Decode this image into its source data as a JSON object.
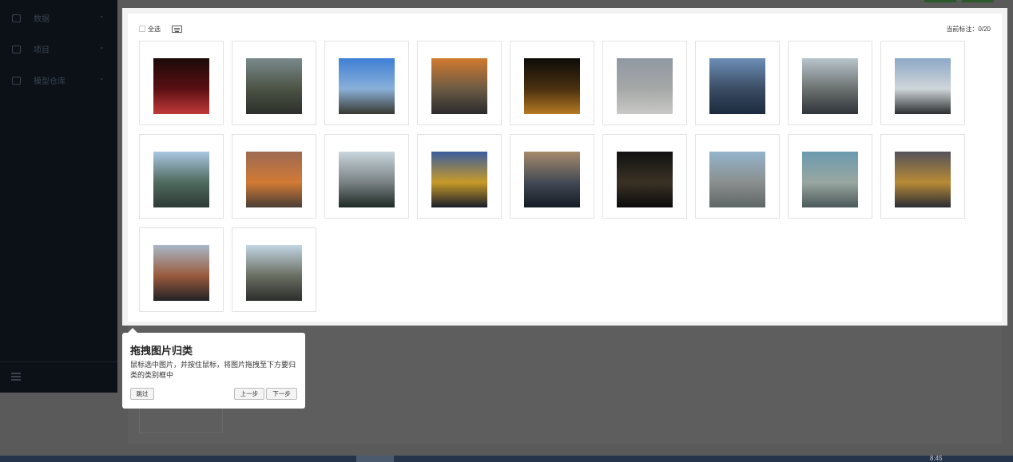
{
  "sidebar": {
    "items": [
      {
        "label": "数据",
        "icon": "database-icon"
      },
      {
        "label": "项目",
        "icon": "project-icon"
      },
      {
        "label": "模型仓库",
        "icon": "model-repo-icon"
      }
    ],
    "collapse_icon": "menu-collapse-icon"
  },
  "toolbar": {
    "select_all_label": "全选",
    "keyboard_icon": "keyboard-icon",
    "annotated_count": "当前标注：0/20"
  },
  "images": [
    {
      "name": "image-01",
      "colors": [
        "#1a0a08",
        "#5a0f12",
        "#c23a3a"
      ]
    },
    {
      "name": "image-02",
      "colors": [
        "#7a8a8c",
        "#4b5344",
        "#2c2f2a"
      ]
    },
    {
      "name": "image-03",
      "colors": [
        "#3f7fd6",
        "#8ab0d8",
        "#383830"
      ]
    },
    {
      "name": "image-04",
      "colors": [
        "#d27a2e",
        "#6b5a44",
        "#2a2a2c"
      ]
    },
    {
      "name": "image-05",
      "colors": [
        "#0d0b08",
        "#4a3110",
        "#b57a22"
      ]
    },
    {
      "name": "image-06",
      "colors": [
        "#8f98a2",
        "#a6a8a8",
        "#c9c9c6"
      ]
    },
    {
      "name": "image-07",
      "colors": [
        "#6c8fb7",
        "#3a4c63",
        "#1b2a3e"
      ]
    },
    {
      "name": "image-08",
      "colors": [
        "#b8c4cc",
        "#6b7170",
        "#2e3438"
      ]
    },
    {
      "name": "image-09",
      "colors": [
        "#8da8c6",
        "#cfd6da",
        "#2b2e30"
      ]
    },
    {
      "name": "image-10",
      "colors": [
        "#a9c7e2",
        "#4f6a5e",
        "#2d3a36"
      ]
    },
    {
      "name": "image-11",
      "colors": [
        "#9c6a52",
        "#d27a35",
        "#4a3e36"
      ]
    },
    {
      "name": "image-12",
      "colors": [
        "#c9d6de",
        "#7a8284",
        "#1e2a24"
      ]
    },
    {
      "name": "image-13",
      "colors": [
        "#3a5d9e",
        "#c79a28",
        "#1a1e2a"
      ]
    },
    {
      "name": "image-14",
      "colors": [
        "#a68a6a",
        "#434a55",
        "#151b25"
      ]
    },
    {
      "name": "image-15",
      "colors": [
        "#111110",
        "#3a3124",
        "#0c0c0c"
      ]
    },
    {
      "name": "image-16",
      "colors": [
        "#94b4cc",
        "#8a8f8e",
        "#5f6766"
      ]
    },
    {
      "name": "image-17",
      "colors": [
        "#6b9ab0",
        "#99a7a0",
        "#4b585a"
      ]
    },
    {
      "name": "image-18",
      "colors": [
        "#53525a",
        "#b88a36",
        "#2a2c35"
      ]
    },
    {
      "name": "image-19",
      "colors": [
        "#a8b8c8",
        "#9a5a3e",
        "#212224"
      ]
    },
    {
      "name": "image-20",
      "colors": [
        "#c2d6e4",
        "#6a6f62",
        "#2c2e2c"
      ]
    }
  ],
  "tour": {
    "title": "拖拽图片归类",
    "description": "鼠标选中图片，并按住鼠标，将图片拖拽至下方要归类的类别框中",
    "skip_label": "跳过",
    "prev_label": "上一步",
    "next_label": "下一步"
  },
  "taskbar": {
    "clock_text": "8:45"
  }
}
